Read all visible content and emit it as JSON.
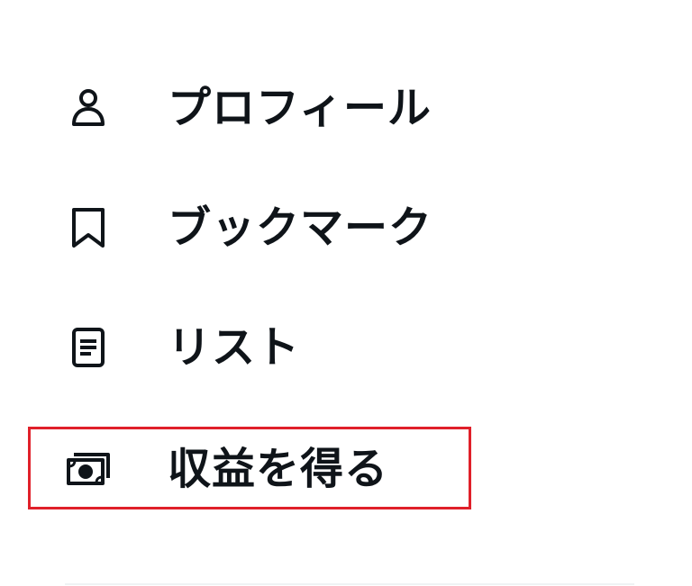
{
  "menu": {
    "items": [
      {
        "icon": "person-icon",
        "label": "プロフィール"
      },
      {
        "icon": "bookmark-icon",
        "label": "ブックマーク"
      },
      {
        "icon": "list-icon",
        "label": "リスト"
      },
      {
        "icon": "money-icon",
        "label": "収益を得る"
      }
    ],
    "highlighted_item": "収益を得る"
  },
  "colors": {
    "text": "#0f1419",
    "highlight_border": "#e0202a",
    "divider": "#eff3f4",
    "background": "#ffffff"
  }
}
